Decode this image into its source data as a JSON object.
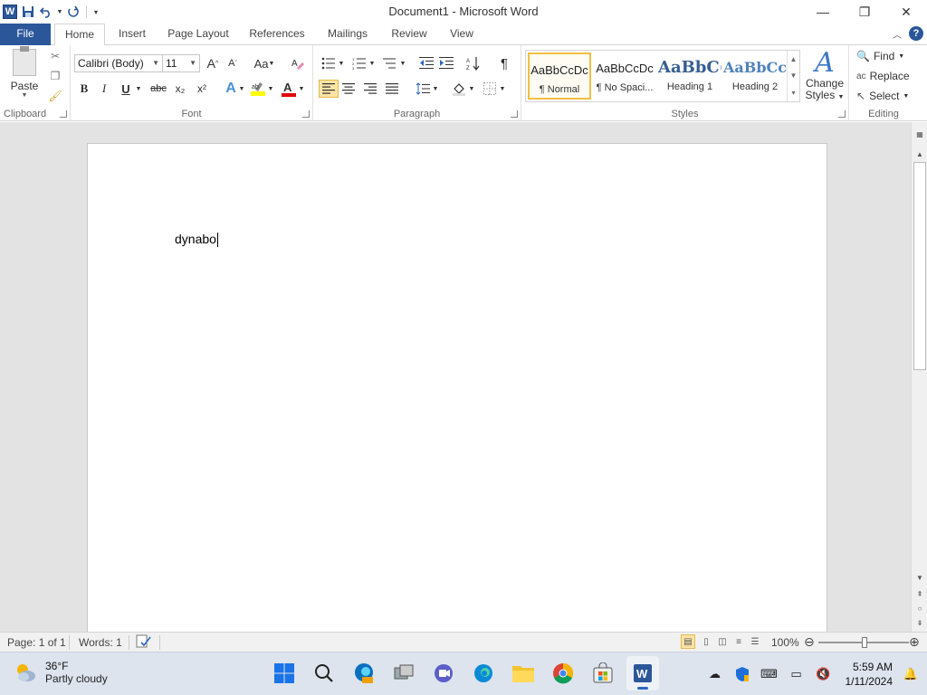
{
  "window": {
    "title": "Document1  -  Microsoft Word",
    "controls": {
      "minimize": "—",
      "restore": "❐",
      "close": "✕"
    }
  },
  "qat": {
    "word_logo": "W"
  },
  "tabs": [
    {
      "label": "File"
    },
    {
      "label": "Home"
    },
    {
      "label": "Insert"
    },
    {
      "label": "Page Layout"
    },
    {
      "label": "References"
    },
    {
      "label": "Mailings"
    },
    {
      "label": "Review"
    },
    {
      "label": "View"
    }
  ],
  "help": "?",
  "ribbon": {
    "clipboard": {
      "label": "Clipboard",
      "paste": "Paste"
    },
    "font": {
      "label": "Font",
      "font_name": "Calibri (Body)",
      "font_size": "11",
      "bold": "B",
      "italic": "I",
      "underline": "U",
      "strike": "abc",
      "subscript": "x₂",
      "superscript": "x²",
      "grow": "A",
      "shrink": "A",
      "case": "Aa"
    },
    "paragraph": {
      "label": "Paragraph",
      "pilcrow": "¶"
    },
    "styles": {
      "label": "Styles",
      "items": [
        {
          "sample": "AaBbCcDc",
          "name": "¶ Normal"
        },
        {
          "sample": "AaBbCcDc",
          "name": "¶ No Spaci..."
        },
        {
          "sample": "AaBbC(",
          "name": "Heading 1"
        },
        {
          "sample": "AaBbCc",
          "name": "Heading 2"
        }
      ],
      "change_styles_line1": "Change",
      "change_styles_line2": "Styles"
    },
    "editing": {
      "label": "Editing",
      "find": "Find",
      "replace": "Replace",
      "select": "Select"
    }
  },
  "document": {
    "text": "dynabo"
  },
  "statusbar": {
    "page": "Page: 1 of 1",
    "words": "Words: 1",
    "zoom": "100%",
    "zoom_level": 1.0
  },
  "taskbar": {
    "weather_temp": "36°F",
    "weather_desc": "Partly cloudy",
    "time": "5:59 AM",
    "date": "1/11/2024"
  },
  "colors": {
    "word_blue": "#2b579a",
    "highlight": "#ffff00",
    "font_color": "#e00000",
    "active_bg": "#fce4a4"
  }
}
